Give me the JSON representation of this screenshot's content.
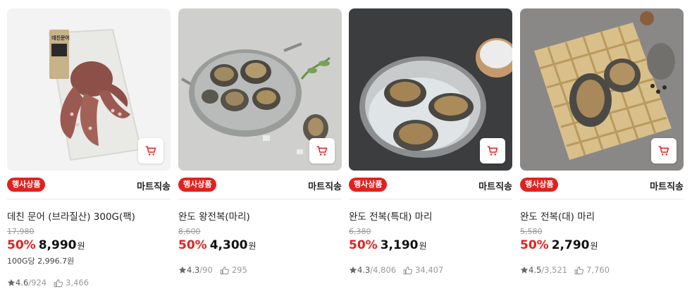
{
  "products": [
    {
      "badge": "행사상품",
      "delivery": "마트직송",
      "name": "데친 문어 (브라질산) 300G(팩)",
      "original_price": "17,980",
      "discount": "50%",
      "price": "8,990",
      "currency": "원",
      "unit_price": "100G당 2,996.7원",
      "rating": "4.6",
      "review_count": "/924",
      "likes": "3,466",
      "package_label": "데친문어"
    },
    {
      "badge": "행사상품",
      "delivery": "마트직송",
      "name": "완도 왕전복(마리)",
      "original_price": "8,600",
      "discount": "50%",
      "price": "4,300",
      "currency": "원",
      "unit_price": "",
      "rating": "4.3",
      "review_count": "/90",
      "likes": "295"
    },
    {
      "badge": "행사상품",
      "delivery": "마트직송",
      "name": "완도 전복(특대) 마리",
      "original_price": "6,380",
      "discount": "50%",
      "price": "3,190",
      "currency": "원",
      "unit_price": "",
      "rating": "4.3",
      "review_count": "/4,806",
      "likes": "34,407"
    },
    {
      "badge": "행사상품",
      "delivery": "마트직송",
      "name": "완도 전복(대) 마리",
      "original_price": "5,580",
      "discount": "50%",
      "price": "2,790",
      "currency": "원",
      "unit_price": "",
      "rating": "4.5",
      "review_count": "/3,521",
      "likes": "7,760"
    }
  ],
  "colors": {
    "accent": "#e0221f",
    "text": "#222222",
    "muted": "#999999"
  },
  "icons": [
    "cart-icon",
    "star-icon",
    "thumbs-up-icon"
  ]
}
